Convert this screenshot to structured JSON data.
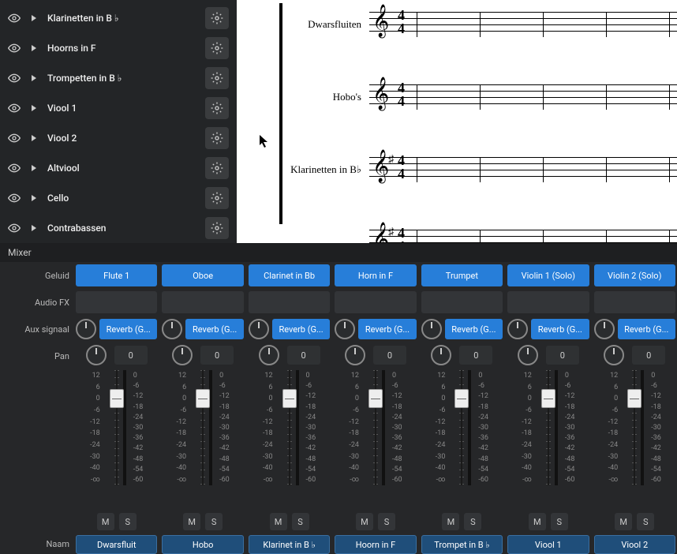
{
  "instruments": [
    {
      "label": "Klarinetten in B ♭"
    },
    {
      "label": "Hoorns in F"
    },
    {
      "label": "Trompetten in B ♭"
    },
    {
      "label": "Viool 1"
    },
    {
      "label": "Viool 2"
    },
    {
      "label": "Altviool"
    },
    {
      "label": "Cello"
    },
    {
      "label": "Contrabassen"
    }
  ],
  "score_staves": [
    {
      "label": "Dwarsfluiten"
    },
    {
      "label": "Hobo's"
    },
    {
      "label": "Klarinetten in B♭"
    },
    {
      "label": ""
    }
  ],
  "mixer": {
    "title": "Mixer",
    "row_labels": {
      "sound": "Geluid",
      "fx": "Audio FX",
      "aux": "Aux signaal",
      "pan": "Pan",
      "name": "Naam"
    },
    "mute": "M",
    "solo": "S",
    "aux_label": "Reverb (G...",
    "scale_left": [
      "12",
      "6",
      "0",
      "-6",
      "-12",
      "-18",
      "-24",
      "-30",
      "-40",
      "-∞"
    ],
    "scale_right": [
      "0",
      "-6",
      "-12",
      "-18",
      "-24",
      "-30",
      "-36",
      "-42",
      "-48",
      "-54",
      "-60"
    ],
    "channels": [
      {
        "sound": "Flute 1",
        "pan": "0",
        "name": "Dwarsfluit"
      },
      {
        "sound": "Oboe",
        "pan": "0",
        "name": "Hobo"
      },
      {
        "sound": "Clarinet in Bb",
        "pan": "0",
        "name": "Klarinet in B ♭"
      },
      {
        "sound": "Horn in F",
        "pan": "0",
        "name": "Hoorn in F"
      },
      {
        "sound": "Trumpet",
        "pan": "0",
        "name": "Trompet in B ♭"
      },
      {
        "sound": "Violin 1 (Solo)",
        "pan": "0",
        "name": "Viool 1"
      },
      {
        "sound": "Violin 2 (Solo)",
        "pan": "0",
        "name": "Viool 2"
      }
    ]
  }
}
